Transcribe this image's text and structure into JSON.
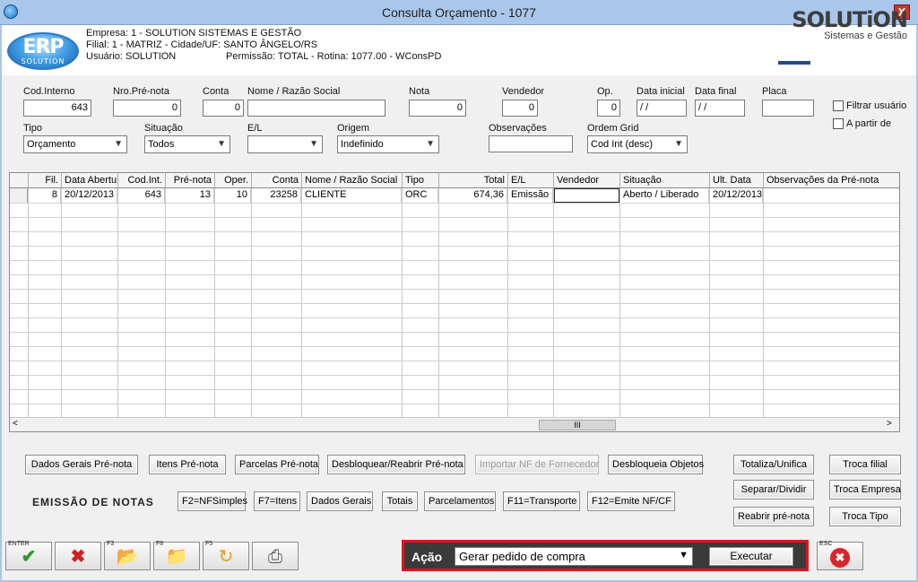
{
  "window": {
    "title": "Consulta Orçamento - 1077",
    "close_label": "X"
  },
  "header": {
    "logo_text": "ERP",
    "logo_sub": "SOLUTION",
    "empresa": "Empresa: 1 - SOLUTION SISTEMAS E GESTÃO",
    "filial": "Filial: 1 - MATRIZ - Cidade/UF: SANTO ÂNGELO/RS",
    "usuario": "Usuário: SOLUTION",
    "permissao": "Permissão: TOTAL - Rotina: 1077.00 - WConsPD",
    "brand_big": "SOLUTiON",
    "brand_small": "Sistemas e Gestão"
  },
  "filters": {
    "cod_interno": {
      "label": "Cod.Interno",
      "value": "643"
    },
    "nro_prenota": {
      "label": "Nro.Pré-nota",
      "value": "0"
    },
    "conta": {
      "label": "Conta",
      "value": "0"
    },
    "nome": {
      "label": "Nome / Razão Social",
      "value": ""
    },
    "nota": {
      "label": "Nota",
      "value": "0"
    },
    "vendedor": {
      "label": "Vendedor",
      "value": "0"
    },
    "op": {
      "label": "Op.",
      "value": "0"
    },
    "data_inicial": {
      "label": "Data inicial",
      "value": "/ /"
    },
    "data_final": {
      "label": "Data final",
      "value": "/ /"
    },
    "placa": {
      "label": "Placa",
      "value": ""
    },
    "filtrar_usuario": "Filtrar usuário",
    "a_partir_de": "A partir de",
    "tipo": {
      "label": "Tipo",
      "value": "Orçamento"
    },
    "situacao": {
      "label": "Situação",
      "value": "Todos"
    },
    "el": {
      "label": "E/L",
      "value": ""
    },
    "origem": {
      "label": "Origem",
      "value": "Indefinido"
    },
    "observacoes": {
      "label": "Observações",
      "value": ""
    },
    "ordem_grid": {
      "label": "Ordem Grid",
      "value": "Cod Int (desc)"
    }
  },
  "grid": {
    "columns": [
      "Fil.",
      "Data Abertu",
      "Cod.Int.",
      "Pré-nota",
      "Oper.",
      "Conta",
      "Nome / Razão Social",
      "Tipo",
      "Total",
      "E/L",
      "Vendedor",
      "Situação",
      "Ult. Data",
      "Observações da Pré-nota"
    ],
    "rows": [
      [
        "8",
        "20/12/2013",
        "643",
        "13",
        "10",
        "23258",
        "CLIENTE",
        "ORC",
        "674,36",
        "Emissão",
        "",
        "Aberto / Liberado",
        "20/12/2013",
        ""
      ]
    ],
    "scroll_grip": "III"
  },
  "buttons": {
    "dados_gerais_prenota": "Dados Gerais Pré-nota",
    "itens_prenota": "Itens Pré-nota",
    "parcelas_prenota": "Parcelas Pré-nota",
    "desbloquear_reabrir": "Desbloquear/Reabrir Pré-nota",
    "importar_nf": "Importar NF de Fornecedor",
    "desbloqueia_objetos": "Desbloqueia Objetos",
    "totaliza_unifica": "Totaliza/Unifica",
    "troca_filial": "Troca filial",
    "separar_dividir": "Separar/Dividir",
    "troca_empresa": "Troca Empresa",
    "reabrir_prenota": "Reabrir pré-nota",
    "troca_tipo": "Troca Tipo",
    "emissao_label": "EMISSÃO DE NOTAS",
    "f2": "F2=NFSimples",
    "f7": "F7=Itens",
    "dados_gerais": "Dados Gerais",
    "totais": "Totais",
    "parcelamentos": "Parcelamentos",
    "f11": "F11=Transporte",
    "f12": "F12=Emite NF/CF"
  },
  "toolbar": {
    "enter_key": "ENTER",
    "f3_key": "F3",
    "f8_key": "F8",
    "f5_key": "F5",
    "esc_key": "ESC",
    "acao_label": "Ação",
    "acao_value": "Gerar pedido de compra",
    "executar": "Executar"
  }
}
